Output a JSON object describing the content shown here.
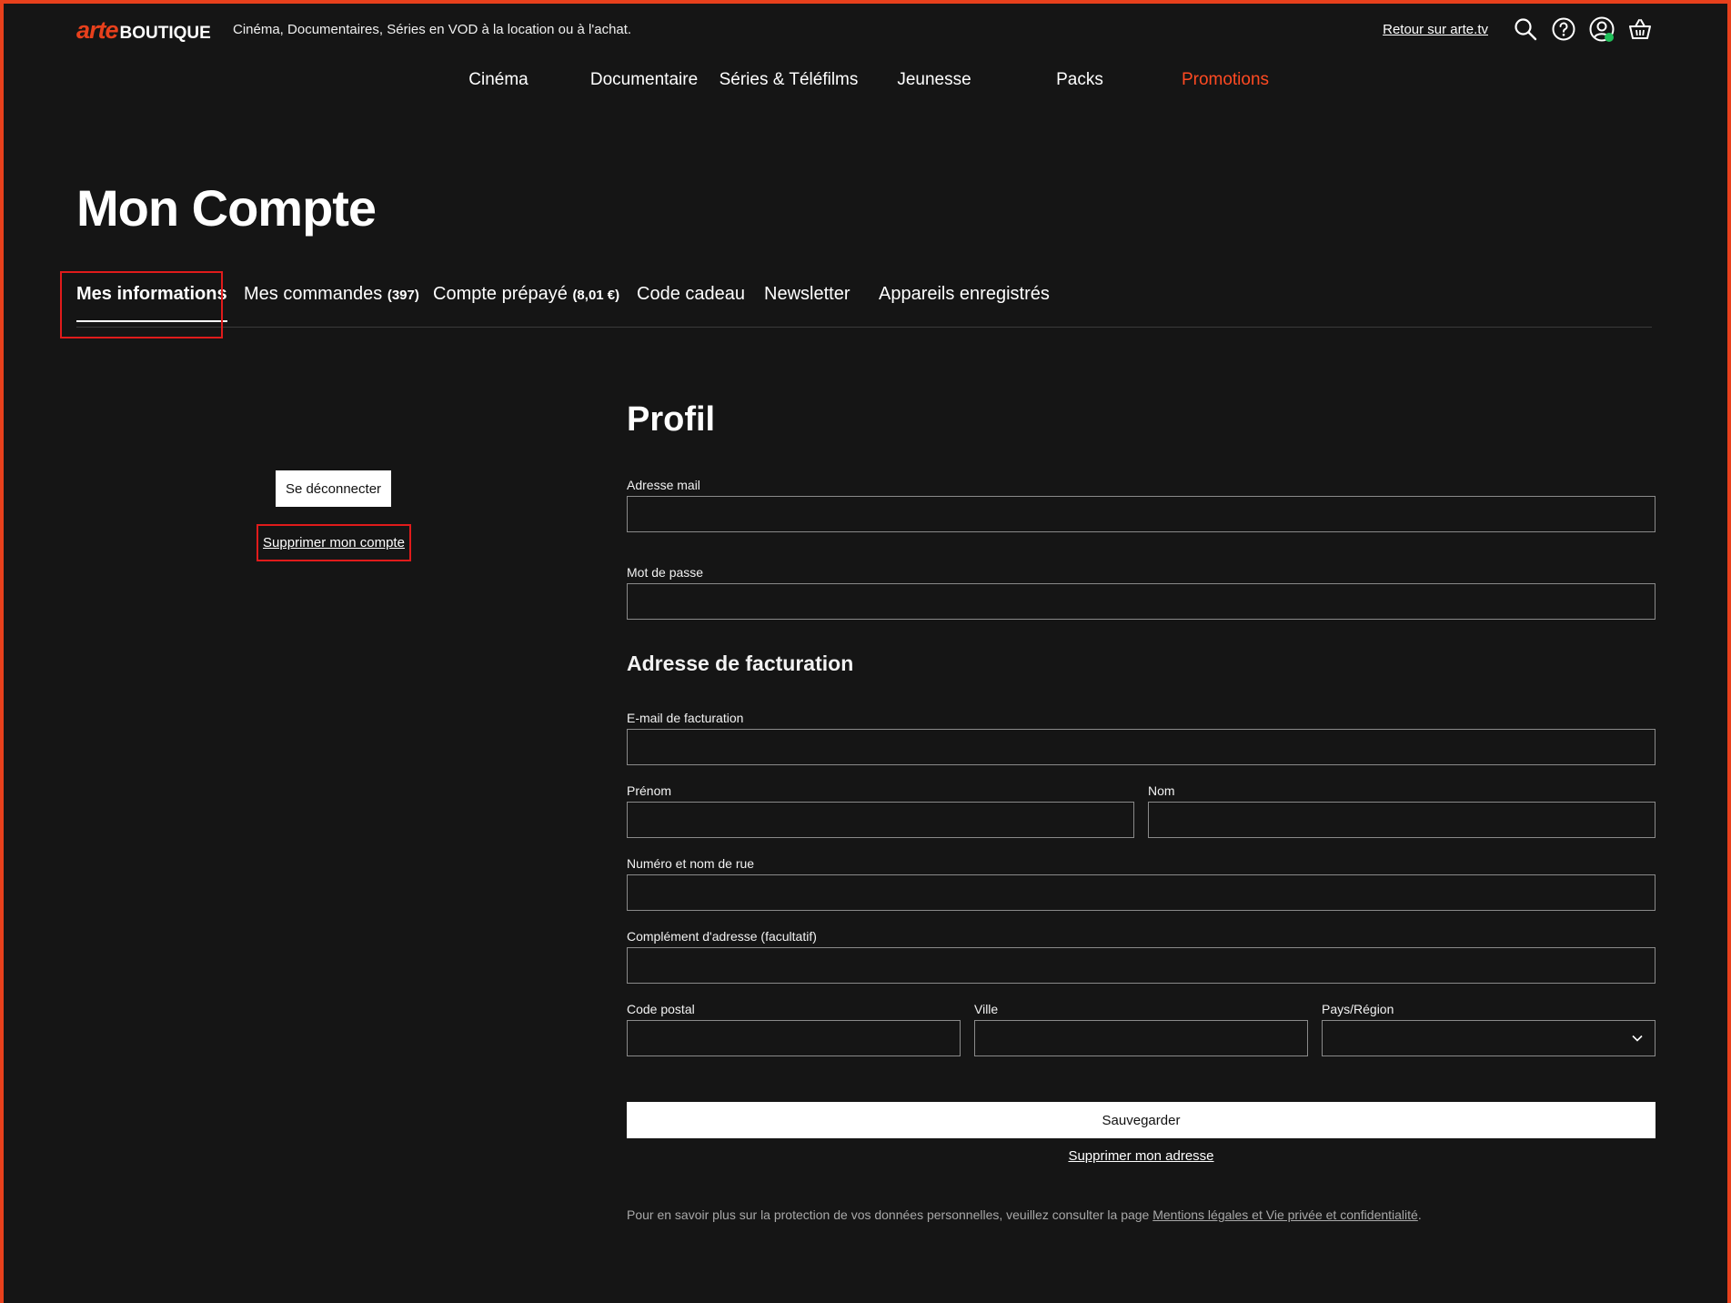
{
  "header": {
    "logo_arte": "arte",
    "logo_boutique": "BOUTIQUE",
    "tagline": "Cinéma, Documentaires, Séries en VOD à la location ou à l'achat.",
    "back_link": "Retour sur arte.tv",
    "icons": [
      "search-icon",
      "help-icon",
      "user-icon",
      "basket-icon"
    ]
  },
  "nav": {
    "items": [
      "Cinéma",
      "Documentaire",
      "Séries & Téléfilms",
      "Jeunesse",
      "Packs",
      "Promotions"
    ],
    "highlight_color": "#ff4a22"
  },
  "page": {
    "title": "Mon Compte"
  },
  "tabs": [
    {
      "label": "Mes informations",
      "count": ""
    },
    {
      "label": "Mes commandes",
      "count": "(397)"
    },
    {
      "label": "Compte prépayé",
      "count": "(8,01 €)"
    },
    {
      "label": "Code cadeau",
      "count": ""
    },
    {
      "label": "Newsletter",
      "count": ""
    },
    {
      "label": "Appareils enregistrés",
      "count": ""
    }
  ],
  "sidebar": {
    "logout": "Se déconnecter",
    "delete_account": "Supprimer mon compte"
  },
  "profile": {
    "heading": "Profil",
    "email_label": "Adresse mail",
    "password_label": "Mot de passe"
  },
  "billing": {
    "heading": "Adresse de facturation",
    "email_label": "E-mail de facturation",
    "firstname_label": "Prénom",
    "lastname_label": "Nom",
    "street_label": "Numéro et nom de rue",
    "complement_label": "Complément d'adresse (facultatif)",
    "zip_label": "Code postal",
    "city_label": "Ville",
    "country_label": "Pays/Région"
  },
  "actions": {
    "save": "Sauvegarder",
    "delete_address": "Supprimer mon adresse"
  },
  "footer": {
    "privacy_text": "Pour en savoir plus sur la protection de vos données personnelles, veuillez consulter la page ",
    "privacy_link": "Mentions légales et Vie privée et confidentialité",
    "privacy_end": "."
  },
  "colors": {
    "accent": "#e8401c",
    "background": "#151515",
    "online": "#21c05a"
  }
}
